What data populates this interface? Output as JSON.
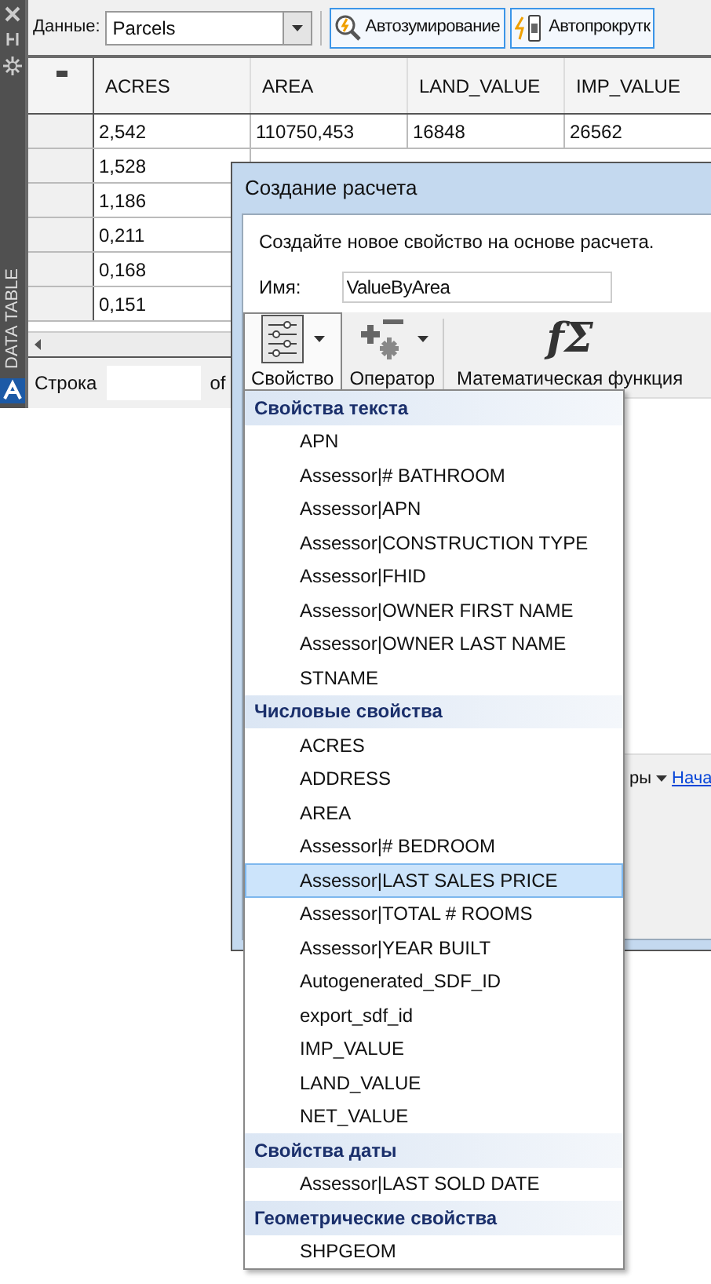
{
  "side_panel": {
    "title": "DATA TABLE"
  },
  "toolbar": {
    "data_label": "Данные:",
    "data_value": "Parcels",
    "buttons": [
      {
        "label": "Автозумирование",
        "kind": "zoom"
      },
      {
        "label": "Автопрокрутк",
        "kind": "scroll"
      }
    ]
  },
  "table": {
    "columns": [
      "ACRES",
      "AREA",
      "LAND_VALUE",
      "IMP_VALUE"
    ],
    "rows": [
      [
        "2,542",
        "110750,453",
        "16848",
        "26562"
      ],
      [
        "1,528"
      ],
      [
        "1,186"
      ],
      [
        "0,211"
      ],
      [
        "0,168"
      ],
      [
        "0,151"
      ]
    ]
  },
  "status": {
    "row_label": "Строка",
    "of_label": "of"
  },
  "dialog": {
    "title": "Создание расчета",
    "description": "Создайте новое свойство на основе расчета.",
    "name_label": "Имя:",
    "name_value": "ValueByArea",
    "tools": [
      {
        "label": "Свойство",
        "kind": "property",
        "has_dropdown": true,
        "selected": true
      },
      {
        "label": "Оператор",
        "kind": "operator",
        "has_dropdown": true,
        "selected": false
      },
      {
        "label": "Математическая функция",
        "kind": "function",
        "glyph": "fΣ",
        "has_dropdown": false,
        "selected": false
      }
    ],
    "footer": {
      "text": "ры",
      "link": "Нача"
    }
  },
  "menu": {
    "groups": [
      {
        "title": "Свойства текста",
        "items": [
          {
            "label": "APN",
            "selected": false
          },
          {
            "label": "Assessor|# BATHROOM",
            "selected": false
          },
          {
            "label": "Assessor|APN",
            "selected": false
          },
          {
            "label": "Assessor|CONSTRUCTION TYPE",
            "selected": false
          },
          {
            "label": "Assessor|FHID",
            "selected": false
          },
          {
            "label": "Assessor|OWNER FIRST NAME",
            "selected": false
          },
          {
            "label": "Assessor|OWNER LAST NAME",
            "selected": false
          },
          {
            "label": "STNAME",
            "selected": false
          }
        ]
      },
      {
        "title": "Числовые свойства",
        "items": [
          {
            "label": "ACRES",
            "selected": false
          },
          {
            "label": "ADDRESS",
            "selected": false
          },
          {
            "label": "AREA",
            "selected": false
          },
          {
            "label": "Assessor|# BEDROOM",
            "selected": false
          },
          {
            "label": "Assessor|LAST SALES PRICE",
            "selected": true
          },
          {
            "label": "Assessor|TOTAL # ROOMS",
            "selected": false
          },
          {
            "label": "Assessor|YEAR BUILT",
            "selected": false
          },
          {
            "label": "Autogenerated_SDF_ID",
            "selected": false
          },
          {
            "label": "export_sdf_id",
            "selected": false
          },
          {
            "label": "IMP_VALUE",
            "selected": false
          },
          {
            "label": "LAND_VALUE",
            "selected": false
          },
          {
            "label": "NET_VALUE",
            "selected": false
          }
        ]
      },
      {
        "title": "Свойства даты",
        "items": [
          {
            "label": "Assessor|LAST SOLD DATE",
            "selected": false
          }
        ]
      },
      {
        "title": "Геометрические свойства",
        "items": [
          {
            "label": "SHPGEOM",
            "selected": false
          }
        ]
      }
    ]
  }
}
